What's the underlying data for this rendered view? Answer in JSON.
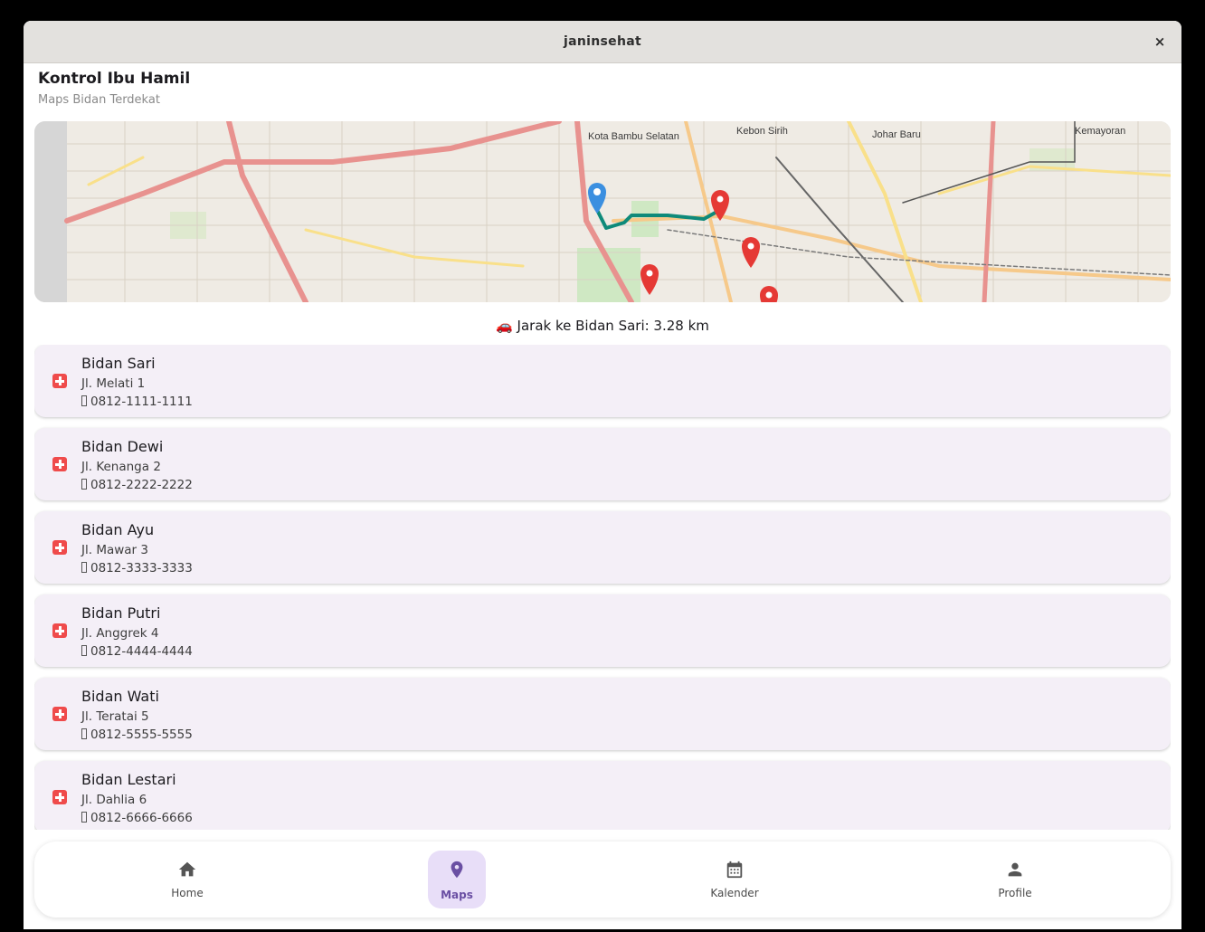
{
  "window": {
    "title": "janinsehat",
    "close_label": "×"
  },
  "header": {
    "title": "Kontrol Ibu Hamil",
    "subtitle": "Maps Bidan Terdekat"
  },
  "map": {
    "labels": [
      "Kota Bambu Selatan",
      "Kebon Sirih",
      "Johar Baru",
      "Kemayoran"
    ],
    "colors": {
      "route": "#0e8a7a",
      "user_marker": "#3b8fe0",
      "bidan_marker": "#e53935"
    }
  },
  "distance_text": "🚗 Jarak ke Bidan Sari: 3.28 km",
  "bidan_list": [
    {
      "name": "Bidan Sari",
      "address": "Jl. Melati 1",
      "phone": "0812-1111-1111"
    },
    {
      "name": "Bidan Dewi",
      "address": "Jl. Kenanga 2",
      "phone": "0812-2222-2222"
    },
    {
      "name": "Bidan Ayu",
      "address": "Jl. Mawar 3",
      "phone": "0812-3333-3333"
    },
    {
      "name": "Bidan Putri",
      "address": "Jl. Anggrek 4",
      "phone": "0812-4444-4444"
    },
    {
      "name": "Bidan Wati",
      "address": "Jl. Teratai 5",
      "phone": "0812-5555-5555"
    },
    {
      "name": "Bidan Lestari",
      "address": "Jl. Dahlia 6",
      "phone": "0812-6666-6666"
    }
  ],
  "nav": [
    {
      "label": "Home",
      "icon": "home-icon",
      "active": false
    },
    {
      "label": "Maps",
      "icon": "location-pin-icon",
      "active": true
    },
    {
      "label": "Kalender",
      "icon": "calendar-icon",
      "active": false
    },
    {
      "label": "Profile",
      "icon": "person-icon",
      "active": false
    }
  ]
}
